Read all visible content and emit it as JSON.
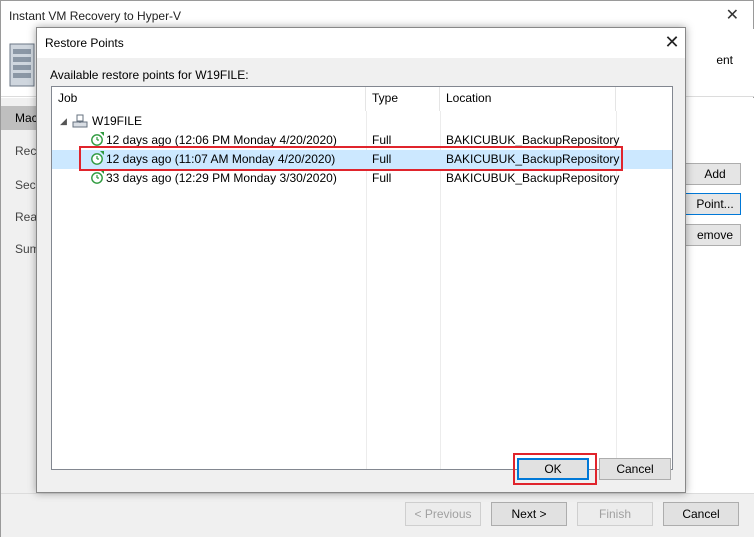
{
  "wizard": {
    "title": "Instant VM Recovery to Hyper-V",
    "close_glyph": "✕",
    "header_text": "ent",
    "nav": [
      "Mac",
      "Reco",
      "Secu",
      "Reas",
      "Sum"
    ],
    "side_buttons": [
      "Add",
      "Point...",
      "emove"
    ],
    "footer_buttons": {
      "previous": "< Previous",
      "next": "Next >",
      "finish": "Finish",
      "cancel": "Cancel"
    }
  },
  "dialog": {
    "title": "Restore Points",
    "close_glyph": "✕",
    "label": "Available restore points for W19FILE:",
    "columns": {
      "job": "Job",
      "type": "Type",
      "location": "Location"
    },
    "job_name": "W19FILE",
    "rows": [
      {
        "job": "12 days ago (12:06 PM Monday 4/20/2020)",
        "type": "Full",
        "location": "BAKICUBUK_BackupRepository"
      },
      {
        "job": "12 days ago (11:07 AM Monday 4/20/2020)",
        "type": "Full",
        "location": "BAKICUBUK_BackupRepository"
      },
      {
        "job": "33 days ago (12:29 PM Monday 3/30/2020)",
        "type": "Full",
        "location": "BAKICUBUK_BackupRepository"
      }
    ],
    "selected_row": 1,
    "ok_label": "OK",
    "cancel_label": "Cancel"
  },
  "colors": {
    "selection": "#cce8ff",
    "highlight": "#e0242c",
    "focus": "#0078d7",
    "restore_point_icon": "#2e9a3e"
  }
}
